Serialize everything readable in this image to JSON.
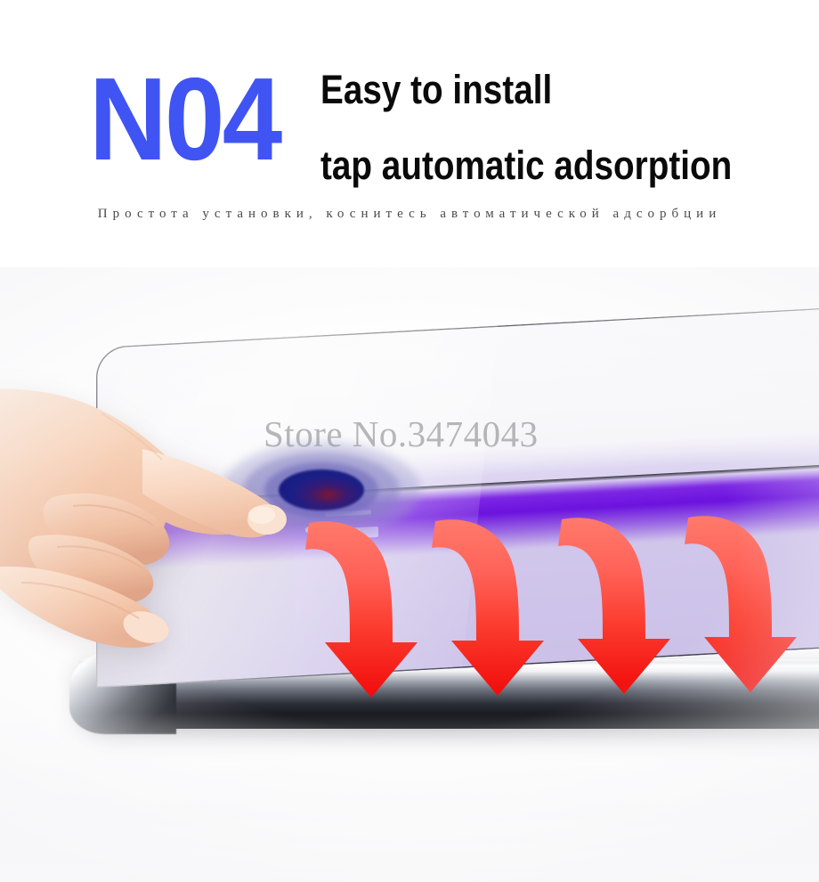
{
  "header": {
    "step_number": "N04",
    "headline_line1": "Easy to install",
    "headline_line2": "tap automatic adsorption",
    "subtitle_ru": "Простота установки, коснитесь автоматической адсорбции"
  },
  "photo": {
    "watermark": "Store No.3474043",
    "description": "Hand tapping a tempered glass screen protector on a phone with downward arrows showing automatic adsorption",
    "arrow_count": 4,
    "icons": {
      "touch_ripple": "touch-ripple-icon",
      "pointing_hand": "pointing-hand-icon",
      "down_arrow": "curved-down-arrow-icon"
    }
  },
  "colors": {
    "step_number_blue": "#3f54f2",
    "headline_black": "#0a0a0a",
    "subtitle_gray": "#4a4a4a",
    "arrow_red_light": "#ff6b5e",
    "arrow_red_dark": "#f41111",
    "ripple_navy": "#1b1f86",
    "screen_violet": "#680cde",
    "screen_lavender": "#cdc2e9",
    "background_white": "#ffffff",
    "watermark_gray": "#8c8c8f"
  }
}
